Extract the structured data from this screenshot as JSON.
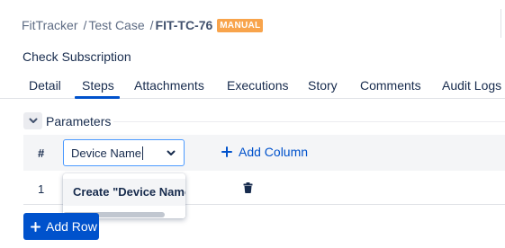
{
  "breadcrumb": {
    "project": "FitTracker",
    "separator1": "/",
    "section": "Test Case",
    "separator2": "/",
    "key": "FIT-TC-76",
    "badge": "MANUAL"
  },
  "page": {
    "title": "Check Subscription"
  },
  "tabs": [
    {
      "label": "Detail",
      "active": false
    },
    {
      "label": "Steps",
      "active": true
    },
    {
      "label": "Attachments",
      "active": false
    },
    {
      "label": "Executions",
      "active": false
    },
    {
      "label": "Story",
      "active": false
    },
    {
      "label": "Comments",
      "active": false
    },
    {
      "label": "Audit Logs",
      "active": false
    }
  ],
  "parameters": {
    "title": "Parameters",
    "header": {
      "index_label": "#",
      "column_input_value": "Device Name",
      "add_column_label": "Add Column"
    },
    "rows": [
      {
        "index": "1"
      }
    ],
    "dropdown": {
      "option_label": "Create \"Device Name\""
    },
    "add_row_label": "Add Row"
  },
  "colors": {
    "accent": "#0052cc",
    "badge": "#f8a44c",
    "focus_border": "#4c9aff",
    "header_bg": "#f4f5f7"
  },
  "icons": {
    "toggle": "chevron-down-icon",
    "select": "chevron-down-icon",
    "add": "plus-icon",
    "delete": "trash-icon"
  }
}
